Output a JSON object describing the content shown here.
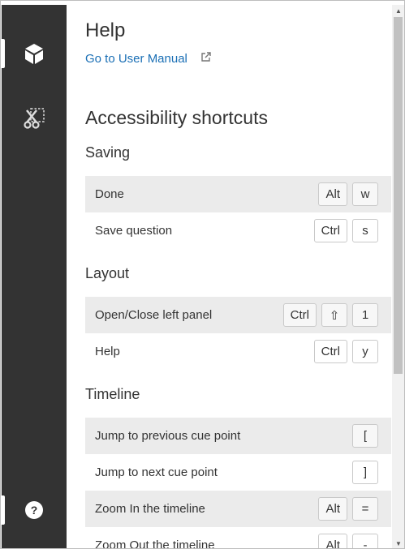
{
  "sidebar": {
    "items": [
      {
        "icon": "cube-icon"
      },
      {
        "icon": "scissors-icon"
      },
      {
        "icon": "help-icon",
        "label": "?"
      }
    ]
  },
  "help": {
    "title": "Help",
    "manual_link": "Go to User Manual"
  },
  "shortcuts": {
    "title": "Accessibility shortcuts",
    "groups": [
      {
        "title": "Saving",
        "rows": [
          {
            "label": "Done",
            "keys": [
              "Alt",
              "w"
            ]
          },
          {
            "label": "Save question",
            "keys": [
              "Ctrl",
              "s"
            ]
          }
        ]
      },
      {
        "title": "Layout",
        "rows": [
          {
            "label": "Open/Close left panel",
            "keys": [
              "Ctrl",
              "⇧",
              "1"
            ]
          },
          {
            "label": "Help",
            "keys": [
              "Ctrl",
              "y"
            ]
          }
        ]
      },
      {
        "title": "Timeline",
        "rows": [
          {
            "label": "Jump to previous cue point",
            "keys": [
              "["
            ]
          },
          {
            "label": "Jump to next cue point",
            "keys": [
              "]"
            ]
          },
          {
            "label": "Zoom In the timeline",
            "keys": [
              "Alt",
              "="
            ]
          },
          {
            "label": "Zoom Out the timeline",
            "keys": [
              "Alt",
              "-"
            ]
          }
        ]
      }
    ]
  },
  "scrollbar": {
    "up_arrow": "▲",
    "down_arrow": "▼"
  }
}
